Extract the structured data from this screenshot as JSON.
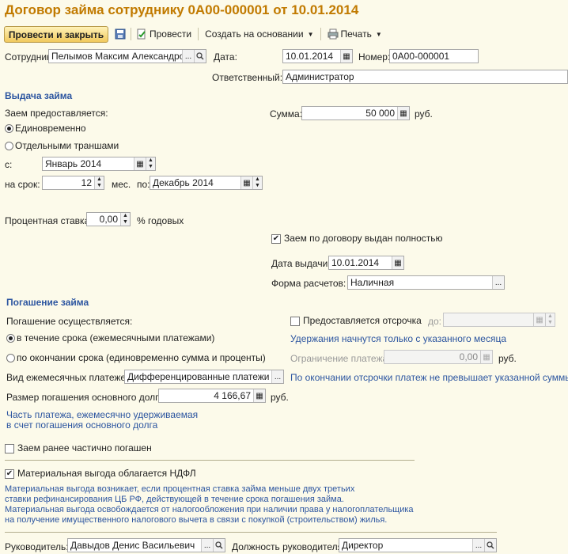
{
  "title": "Договор займа сотруднику 0А00-000001 от 10.01.2014",
  "toolbar": {
    "post_close": "Провести и закрыть",
    "post": "Провести",
    "create_based": "Создать на основании",
    "print": "Печать"
  },
  "header": {
    "employee_label": "Сотрудник:",
    "employee_value": "Пелымов Максим Александрович",
    "date_label": "Дата:",
    "date_value": "10.01.2014",
    "number_label": "Номер:",
    "number_value": "0А00-000001",
    "responsible_label": "Ответственный:",
    "responsible_value": "Администратор"
  },
  "issue": {
    "section": "Выдача займа",
    "provided_label": "Заем предоставляется:",
    "opt_once": "Единовременно",
    "opt_tranches": "Отдельными траншами",
    "sum_label": "Сумма:",
    "sum_value": "50 000",
    "currency": "руб.",
    "from_label": "с:",
    "from_value": "Январь 2014",
    "term_label": "на срок:",
    "term_value": "12",
    "months": "мес.",
    "to_label": "по:",
    "to_value": "Декабрь 2014",
    "rate_label": "Процентная ставка:",
    "rate_value": "0,00",
    "rate_unit": "% годовых",
    "fully_issued": "Заем по договору выдан полностью",
    "issue_date_label": "Дата выдачи:",
    "issue_date_value": "10.01.2014",
    "payment_form_label": "Форма расчетов:",
    "payment_form_value": "Наличная"
  },
  "repay": {
    "section": "Погашение займа",
    "performed_label": "Погашение осуществляется:",
    "opt_during": "в течение срока (ежемесячными платежами)",
    "opt_end": "по окончании срока (единовременно сумма и проценты)",
    "deferral_label": "Предоставляется отсрочка",
    "until_label": "до:",
    "deferral_note": "Удержания начнутся только с указанного месяца",
    "limit_label": "Ограничение платежа:",
    "limit_value": "0,00",
    "currency": "руб.",
    "monthly_type_label": "Вид ежемесячных платежей:",
    "monthly_type_value": "Дифференцированные платежи",
    "deferral_note2": "По окончании отсрочки платеж не превышает указанной суммы",
    "principal_label": "Размер погашения основного долга:",
    "principal_value": "4 166,67",
    "note_line1": "Часть платежа, ежемесячно удерживаемая",
    "note_line2": "в счет погашения основного долга",
    "partially_repaid": "Заем ранее частично погашен"
  },
  "benefit": {
    "ndfl_label": "Материальная выгода облагается НДФЛ",
    "text1": "Материальная выгода возникает, если процентная ставка займа меньше двух третьих",
    "text2": "ставки рефинансирования ЦБ РФ, действующей в течение срока погашения займа.",
    "text3": "Материальная выгода освобождается от налогообложения при наличии права у налогоплательщика",
    "text4": "на получение имущественного налогового вычета в связи с покупкой (строительством) жилья."
  },
  "footer": {
    "head_label": "Руководитель:",
    "head_value": "Давыдов Денис Васильевич",
    "position_label": "Должность руководителя:",
    "position_value": "Директор"
  },
  "colors": {
    "accent": "#c17a00",
    "section": "#2c55a0",
    "background": "#fcfaea"
  }
}
